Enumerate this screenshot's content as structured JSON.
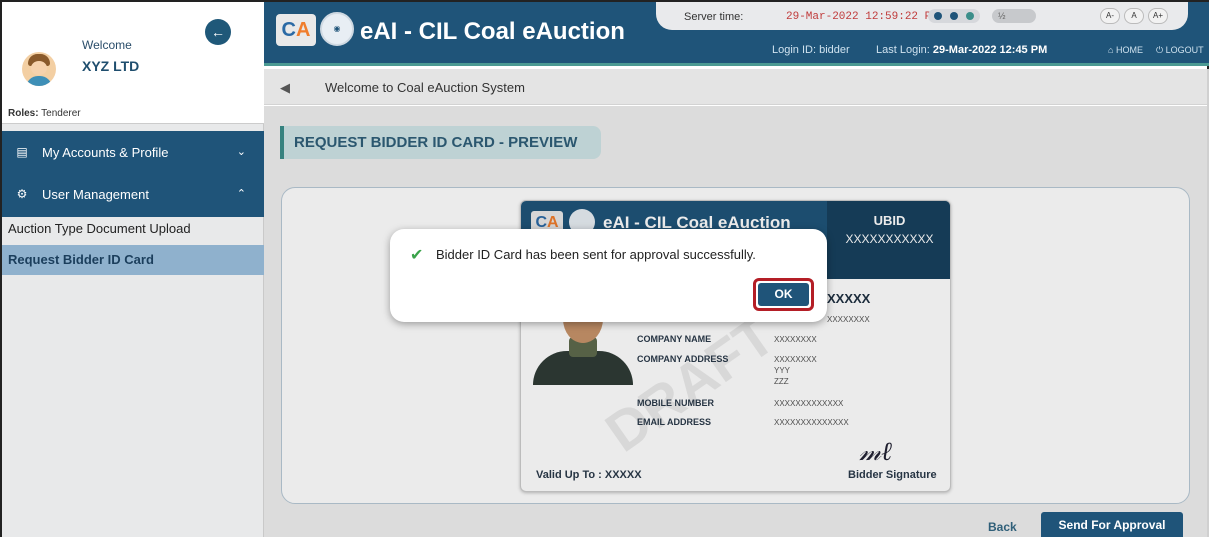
{
  "sidebar": {
    "welcome": "Welcome",
    "company": "XYZ LTD",
    "roles_label": "Roles:",
    "roles_value": "Tenderer",
    "back_icon": "arrow-left-icon",
    "menus": [
      {
        "label": "My Accounts & Profile",
        "icon": "id-card-icon",
        "chevron": "chevron-down-icon"
      },
      {
        "label": "User Management",
        "icon": "users-gear-icon",
        "chevron": "chevron-up-icon"
      }
    ],
    "subitems": [
      {
        "label": "Auction Type Document Upload",
        "active": false
      },
      {
        "label": "Request Bidder ID Card",
        "active": true
      }
    ]
  },
  "header": {
    "app_title": "eAI - CIL Coal eAuction",
    "server_time_label": "Server time:",
    "server_time_value": "29-Mar-2022 12:59:22 PM",
    "login_id_label": "Login ID:",
    "login_id_value": "bidder",
    "last_login_label": "Last Login:",
    "last_login_value": "29-Mar-2022 12:45 PM",
    "home_label": "HOME",
    "logout_label": "LOGOUT",
    "font_buttons": [
      "A-",
      "A",
      "A+"
    ],
    "theme_colors": [
      "#1f5479",
      "#1f5479",
      "#3b8e8a"
    ]
  },
  "notice": {
    "text": "Welcome to Coal eAuction System"
  },
  "page": {
    "title": "REQUEST BIDDER ID CARD - PREVIEW"
  },
  "card": {
    "title": "eAI - CIL Coal eAuction",
    "ubid_label": "UBID",
    "ubid_value": "XXXXXXXXXXX",
    "name_value": "XXXXX",
    "name_sub": "XXXXXXXX",
    "fields": [
      {
        "label": "COMPANY NAME",
        "value": "XXXXXXXX"
      },
      {
        "label": "COMPANY ADDRESS",
        "value": "XXXXXXXX"
      },
      {
        "label": "",
        "value": "YYY"
      },
      {
        "label": "",
        "value": "ZZZ"
      },
      {
        "label": "MOBILE NUMBER",
        "value": "XXXXXXXXXXXXX"
      },
      {
        "label": "EMAIL ADDRESS",
        "value": "XXXXXXXXXXXXXX"
      }
    ],
    "valid_up_to": "Valid Up To : XXXXX",
    "signature_label": "Bidder Signature"
  },
  "modal": {
    "message": "Bidder ID Card has been sent for approval successfully.",
    "ok_label": "OK"
  },
  "actions": {
    "back_label": "Back",
    "send_label": "Send For Approval"
  }
}
